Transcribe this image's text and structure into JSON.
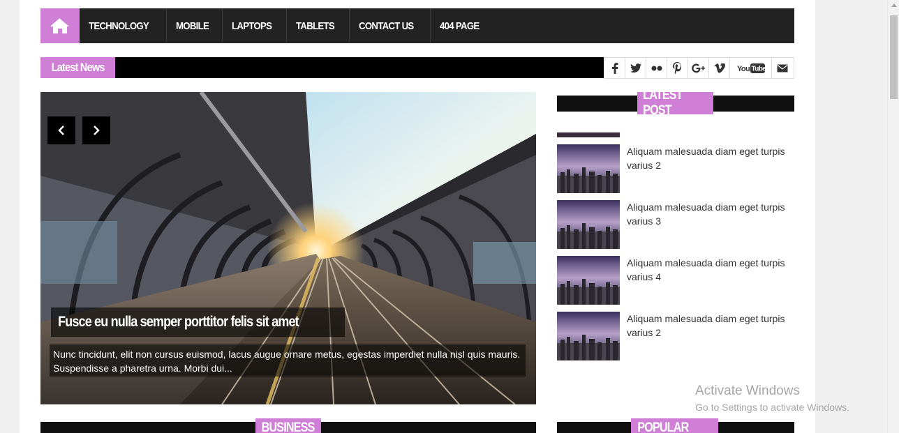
{
  "nav": {
    "items": [
      {
        "label": "TECHNOLOGY"
      },
      {
        "label": "MOBILE"
      },
      {
        "label": "LAPTOPS"
      },
      {
        "label": "TABLETS"
      },
      {
        "label": "CONTACT US"
      },
      {
        "label": "404 PAGE"
      }
    ]
  },
  "ticker": {
    "label": "Latest News"
  },
  "social": {
    "icons": [
      "facebook-icon",
      "twitter-icon",
      "flickr-icon",
      "pinterest-icon",
      "google-plus-icon",
      "vimeo-icon",
      "youtube-icon",
      "email-icon"
    ],
    "youtube_label": "YouTube"
  },
  "slider": {
    "title": "Fusce eu nulla semper porttitor felis sit amet",
    "excerpt": "Nunc tincidunt, elit non cursus euismod, lacus augue ornare metus, egestas imperdiet nulla nisl quis mauris. Suspendisse a pharetra urna. Morbi dui..."
  },
  "sidebar": {
    "latest_heading": "LATEST POST",
    "posts": [
      {
        "title": "Aliquam malesuada diam eget turpis varius 2"
      },
      {
        "title": "Aliquam malesuada diam eget turpis varius 3"
      },
      {
        "title": "Aliquam malesuada diam eget turpis varius 4"
      },
      {
        "title": "Aliquam malesuada diam eget turpis varius 2"
      }
    ],
    "popular_heading": "POPULAR POST"
  },
  "sections": {
    "business_heading": "BUSINESS"
  },
  "watermark": {
    "line1": "Activate Windows",
    "line2": "Go to Settings to activate Windows."
  },
  "colors": {
    "accent": "#cf7fd6",
    "nav_bg": "#222222"
  }
}
